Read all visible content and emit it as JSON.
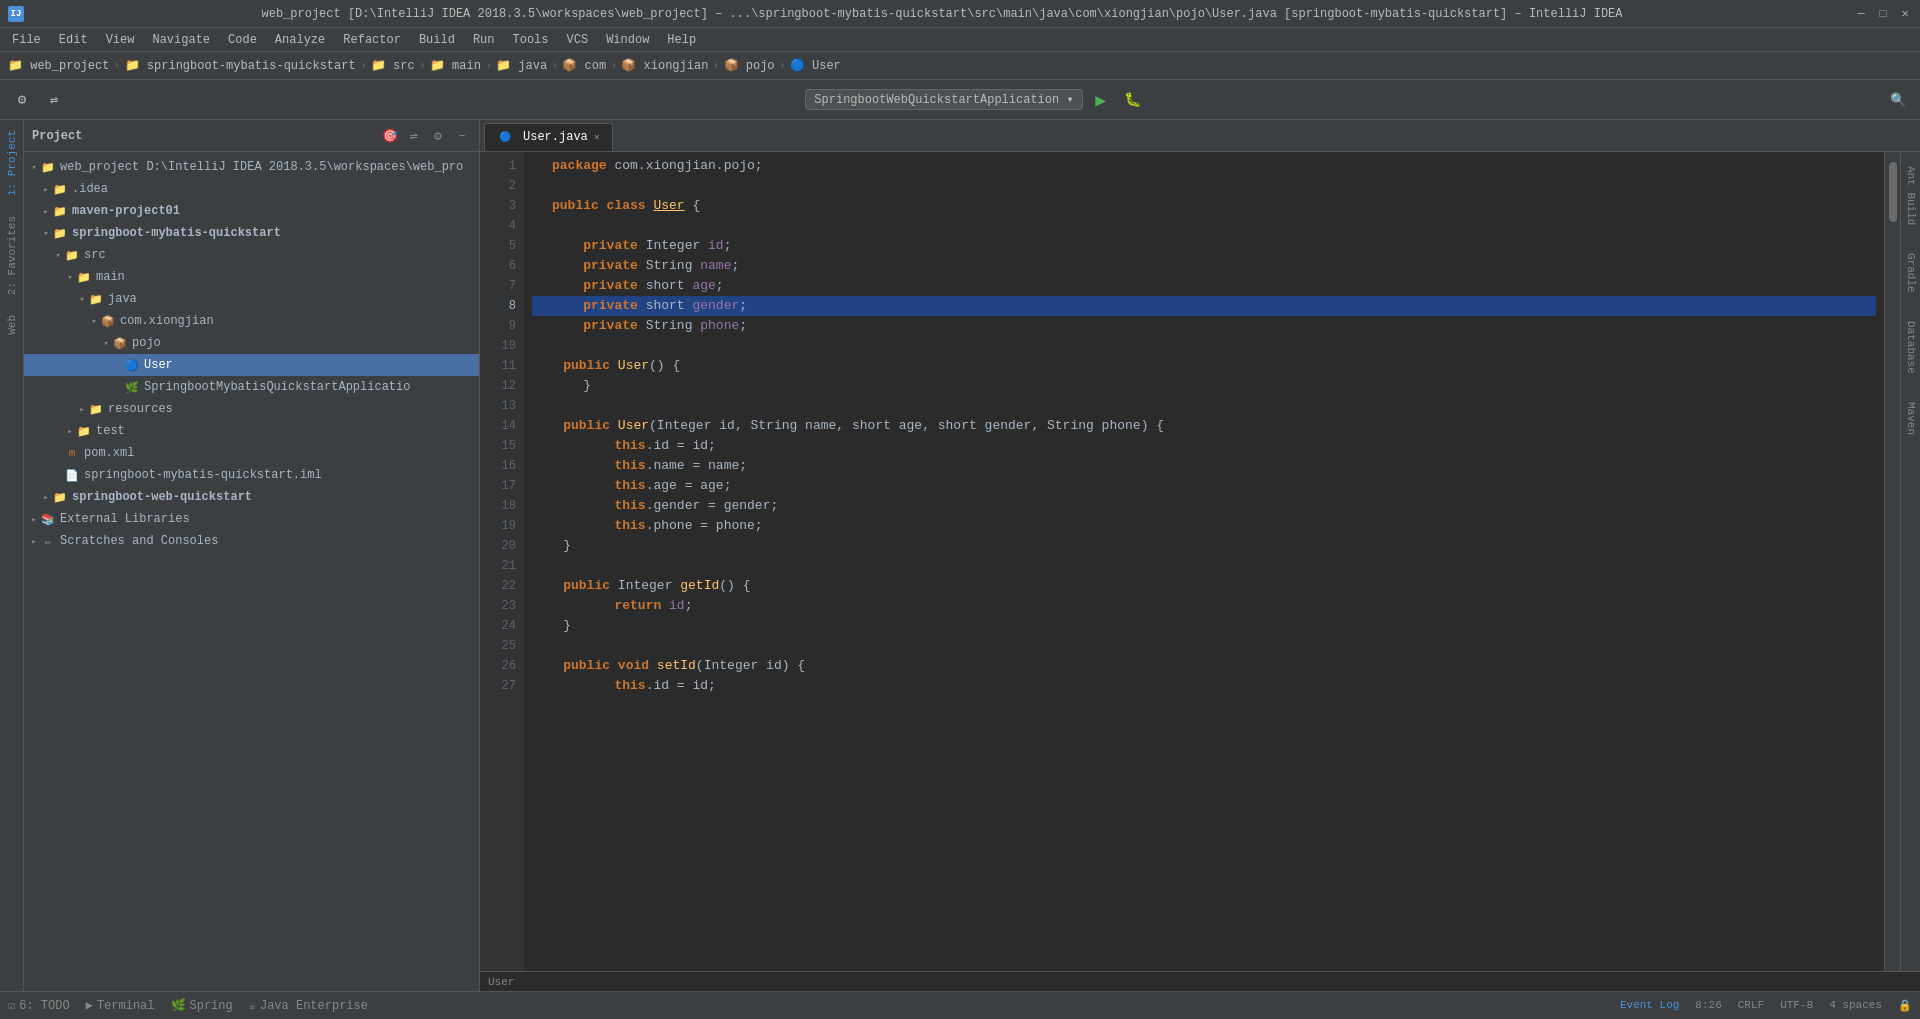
{
  "window": {
    "title": "web_project [D:\\IntelliJ IDEA 2018.3.5\\workspaces\\web_project] – ...\\springboot-mybatis-quickstart\\src\\main\\java\\com\\xiongjian\\pojo\\User.java [springboot-mybatis-quickstart] – IntelliJ IDEA",
    "icon": "IJ"
  },
  "menu": {
    "items": [
      "File",
      "Edit",
      "View",
      "Navigate",
      "Code",
      "Analyze",
      "Refactor",
      "Build",
      "Run",
      "Tools",
      "VCS",
      "Window",
      "Help"
    ]
  },
  "breadcrumb": {
    "items": [
      "web_project",
      "springboot-mybatis-quickstart",
      "src",
      "main",
      "java",
      "com",
      "xiongjian",
      "pojo",
      "User"
    ]
  },
  "toolbar": {
    "run_config": "SpringbootWebQuickstartApplication",
    "search_label": "🔍"
  },
  "project_panel": {
    "title": "Project",
    "tree": [
      {
        "label": "web_project  D:\\IntelliJ IDEA 2018.3.5\\workspaces\\web_pro",
        "indent": 0,
        "type": "project",
        "expanded": true
      },
      {
        "label": ".idea",
        "indent": 1,
        "type": "folder",
        "expanded": false
      },
      {
        "label": "maven-project01",
        "indent": 1,
        "type": "folder-bold",
        "expanded": false
      },
      {
        "label": "springboot-mybatis-quickstart",
        "indent": 1,
        "type": "folder-bold",
        "expanded": true
      },
      {
        "label": "src",
        "indent": 2,
        "type": "folder",
        "expanded": true
      },
      {
        "label": "main",
        "indent": 3,
        "type": "folder",
        "expanded": true
      },
      {
        "label": "java",
        "indent": 4,
        "type": "folder",
        "expanded": true
      },
      {
        "label": "com.xiongjian",
        "indent": 5,
        "type": "package",
        "expanded": true
      },
      {
        "label": "pojo",
        "indent": 6,
        "type": "package",
        "expanded": true
      },
      {
        "label": "User",
        "indent": 7,
        "type": "class",
        "expanded": false,
        "selected": true
      },
      {
        "label": "SpringbootMybatisQuickstartApplicatio",
        "indent": 7,
        "type": "spring",
        "expanded": false
      },
      {
        "label": "resources",
        "indent": 4,
        "type": "folder",
        "expanded": false
      },
      {
        "label": "test",
        "indent": 3,
        "type": "folder",
        "expanded": false
      },
      {
        "label": "pom.xml",
        "indent": 2,
        "type": "xml",
        "expanded": false
      },
      {
        "label": "springboot-mybatis-quickstart.iml",
        "indent": 2,
        "type": "iml",
        "expanded": false
      },
      {
        "label": "springboot-web-quickstart",
        "indent": 1,
        "type": "folder-bold",
        "expanded": false
      },
      {
        "label": "External Libraries",
        "indent": 0,
        "type": "library",
        "expanded": false
      },
      {
        "label": "Scratches and Consoles",
        "indent": 0,
        "type": "scratch",
        "expanded": false
      }
    ]
  },
  "editor": {
    "tab": "User.java",
    "lines": [
      {
        "num": 1,
        "content": "package com.xiongjian.pojo;",
        "tokens": [
          {
            "text": "package ",
            "cls": "kw"
          },
          {
            "text": "com.xiongjian.pojo",
            "cls": "type"
          },
          {
            "text": ";",
            "cls": "punct"
          }
        ]
      },
      {
        "num": 2,
        "content": "",
        "tokens": []
      },
      {
        "num": 3,
        "content": "public class User {",
        "tokens": [
          {
            "text": "public ",
            "cls": "kw"
          },
          {
            "text": "class ",
            "cls": "kw"
          },
          {
            "text": "User",
            "cls": "type-name"
          },
          {
            "text": " {",
            "cls": "punct"
          }
        ]
      },
      {
        "num": 4,
        "content": "",
        "tokens": []
      },
      {
        "num": 5,
        "content": "    private Integer id;",
        "tokens": [
          {
            "text": "    "
          },
          {
            "text": "private ",
            "cls": "kw"
          },
          {
            "text": "Integer ",
            "cls": "type"
          },
          {
            "text": "id",
            "cls": "field"
          },
          {
            "text": ";",
            "cls": "punct"
          }
        ]
      },
      {
        "num": 6,
        "content": "    private String name;",
        "tokens": [
          {
            "text": "    "
          },
          {
            "text": "private ",
            "cls": "kw"
          },
          {
            "text": "String ",
            "cls": "type"
          },
          {
            "text": "name",
            "cls": "field"
          },
          {
            "text": ";",
            "cls": "punct"
          }
        ]
      },
      {
        "num": 7,
        "content": "    private short age;",
        "tokens": [
          {
            "text": "    "
          },
          {
            "text": "private ",
            "cls": "kw"
          },
          {
            "text": "short ",
            "cls": "type"
          },
          {
            "text": "age",
            "cls": "field"
          },
          {
            "text": ";",
            "cls": "punct"
          }
        ]
      },
      {
        "num": 8,
        "content": "    private short gender;",
        "tokens": [
          {
            "text": "    "
          },
          {
            "text": "private ",
            "cls": "kw"
          },
          {
            "text": "short ",
            "cls": "type"
          },
          {
            "text": "gender",
            "cls": "field"
          },
          {
            "text": ";",
            "cls": "punct"
          }
        ],
        "highlighted": true
      },
      {
        "num": 9,
        "content": "    private String phone;",
        "tokens": [
          {
            "text": "    "
          },
          {
            "text": "private ",
            "cls": "kw"
          },
          {
            "text": "String ",
            "cls": "type"
          },
          {
            "text": "phone",
            "cls": "field"
          },
          {
            "text": ";",
            "cls": "punct"
          }
        ]
      },
      {
        "num": 10,
        "content": "",
        "tokens": []
      },
      {
        "num": 11,
        "content": "    public User() {",
        "tokens": [
          {
            "text": "    "
          },
          {
            "text": "public ",
            "cls": "kw"
          },
          {
            "text": "User",
            "cls": "method"
          },
          {
            "text": "() {",
            "cls": "punct"
          }
        ],
        "foldable": true
      },
      {
        "num": 12,
        "content": "    }",
        "tokens": [
          {
            "text": "    }",
            "cls": "punct"
          }
        ]
      },
      {
        "num": 13,
        "content": "",
        "tokens": []
      },
      {
        "num": 14,
        "content": "    public User(Integer id, String name, short age, short gender, String phone) {",
        "tokens": [
          {
            "text": "    "
          },
          {
            "text": "public ",
            "cls": "kw"
          },
          {
            "text": "User",
            "cls": "method"
          },
          {
            "text": "(",
            "cls": "punct"
          },
          {
            "text": "Integer ",
            "cls": "type"
          },
          {
            "text": "id",
            "cls": "param"
          },
          {
            "text": ", ",
            "cls": "punct"
          },
          {
            "text": "String ",
            "cls": "type"
          },
          {
            "text": "name",
            "cls": "param"
          },
          {
            "text": ", ",
            "cls": "punct"
          },
          {
            "text": "short ",
            "cls": "type"
          },
          {
            "text": "age",
            "cls": "param"
          },
          {
            "text": ", ",
            "cls": "punct"
          },
          {
            "text": "short ",
            "cls": "type"
          },
          {
            "text": "gender",
            "cls": "param"
          },
          {
            "text": ", ",
            "cls": "punct"
          },
          {
            "text": "String ",
            "cls": "type"
          },
          {
            "text": "phone",
            "cls": "param"
          },
          {
            "text": ") {",
            "cls": "punct"
          }
        ],
        "foldable": true
      },
      {
        "num": 15,
        "content": "        this.id = id;",
        "tokens": [
          {
            "text": "        "
          },
          {
            "text": "this",
            "cls": "kw"
          },
          {
            "text": ".id = id;",
            "cls": "type"
          }
        ]
      },
      {
        "num": 16,
        "content": "        this.name = name;",
        "tokens": [
          {
            "text": "        "
          },
          {
            "text": "this",
            "cls": "kw"
          },
          {
            "text": ".name = name;",
            "cls": "type"
          }
        ]
      },
      {
        "num": 17,
        "content": "        this.age = age;",
        "tokens": [
          {
            "text": "        "
          },
          {
            "text": "this",
            "cls": "kw"
          },
          {
            "text": ".age = age;",
            "cls": "type"
          }
        ]
      },
      {
        "num": 18,
        "content": "        this.gender = gender;",
        "tokens": [
          {
            "text": "        "
          },
          {
            "text": "this",
            "cls": "kw"
          },
          {
            "text": ".gender = gender;",
            "cls": "type"
          }
        ]
      },
      {
        "num": 19,
        "content": "        this.phone = phone;",
        "tokens": [
          {
            "text": "        "
          },
          {
            "text": "this",
            "cls": "kw"
          },
          {
            "text": ".phone = phone;",
            "cls": "type"
          }
        ]
      },
      {
        "num": 20,
        "content": "    }",
        "tokens": [
          {
            "text": "    }",
            "cls": "punct"
          }
        ],
        "foldable": true
      },
      {
        "num": 21,
        "content": "",
        "tokens": []
      },
      {
        "num": 22,
        "content": "    public Integer getId() {",
        "tokens": [
          {
            "text": "    "
          },
          {
            "text": "public ",
            "cls": "kw"
          },
          {
            "text": "Integer ",
            "cls": "type"
          },
          {
            "text": "getId",
            "cls": "method"
          },
          {
            "text": "() {",
            "cls": "punct"
          }
        ],
        "foldable": true
      },
      {
        "num": 23,
        "content": "        return id;",
        "tokens": [
          {
            "text": "        "
          },
          {
            "text": "return ",
            "cls": "kw"
          },
          {
            "text": "id",
            "cls": "field"
          },
          {
            "text": ";",
            "cls": "punct"
          }
        ]
      },
      {
        "num": 24,
        "content": "    }",
        "tokens": [
          {
            "text": "    }",
            "cls": "punct"
          }
        ],
        "foldable": true
      },
      {
        "num": 25,
        "content": "",
        "tokens": []
      },
      {
        "num": 26,
        "content": "    public void setId(Integer id) {",
        "tokens": [
          {
            "text": "    "
          },
          {
            "text": "public ",
            "cls": "kw"
          },
          {
            "text": "void ",
            "cls": "kw"
          },
          {
            "text": "setId",
            "cls": "method"
          },
          {
            "text": "(",
            "cls": "punct"
          },
          {
            "text": "Integer ",
            "cls": "type"
          },
          {
            "text": "id",
            "cls": "param"
          },
          {
            "text": ") {",
            "cls": "punct"
          }
        ],
        "foldable": true
      },
      {
        "num": 27,
        "content": "        this.id = id;",
        "tokens": [
          {
            "text": "        "
          },
          {
            "text": "this",
            "cls": "kw"
          },
          {
            "text": ".id = id;",
            "cls": "type"
          }
        ]
      }
    ],
    "cursor_line": 8,
    "cursor_col": 26
  },
  "status_bar": {
    "position": "8:26",
    "line_endings": "CRLF",
    "encoding": "UTF-8",
    "indent": "4 spaces",
    "event_log": "Event Log"
  },
  "bottom_toolbar": {
    "items": [
      {
        "label": "6: TODO",
        "icon": "☑"
      },
      {
        "label": "Terminal",
        "icon": ">_"
      },
      {
        "label": "Spring",
        "icon": "🌿"
      },
      {
        "label": "Java Enterprise",
        "icon": "☕"
      }
    ]
  },
  "right_tabs": [
    "Ant Build",
    "Gradle",
    "Database",
    "Maven"
  ],
  "left_tabs": [
    "1: Project",
    "2: Favorites",
    "Web"
  ],
  "bottom_status_label": "User"
}
